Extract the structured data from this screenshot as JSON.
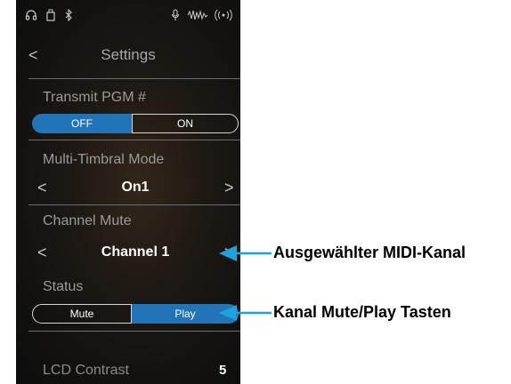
{
  "status_bar": {
    "icons": [
      "headphones-icon",
      "usb-memory-icon",
      "bluetooth-icon",
      "microphone-icon",
      "audio-waveform-icon",
      "wireless-signal-icon"
    ]
  },
  "nav": {
    "back_glyph": "<",
    "title": "Settings"
  },
  "transmit_pgm": {
    "label": "Transmit PGM #",
    "off": "OFF",
    "on": "ON",
    "selected": "OFF"
  },
  "multi_timbral": {
    "label": "Multi-Timbral Mode",
    "value": "On1",
    "prev": "<",
    "next": ">"
  },
  "channel_mute": {
    "label": "Channel Mute",
    "value": "Channel 1",
    "prev": "<",
    "next": ">"
  },
  "status": {
    "label": "Status",
    "mute": "Mute",
    "play": "Play",
    "selected": "Play"
  },
  "lcd_contrast": {
    "label": "LCD Contrast",
    "value": "5"
  },
  "callouts": {
    "channel": "Ausgewählter MIDI-Kanal",
    "buttons": "Kanal Mute/Play Tasten"
  },
  "colors": {
    "accent": "#2274b9",
    "arrow": "#1aa3dd"
  }
}
